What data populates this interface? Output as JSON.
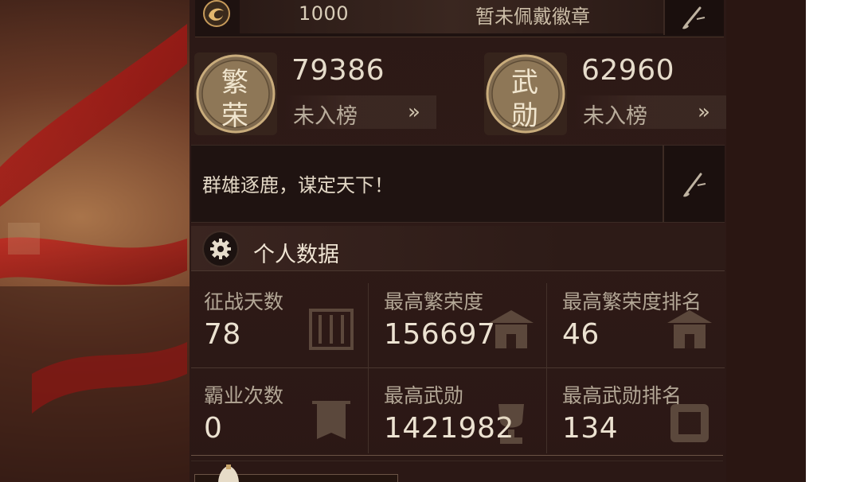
{
  "badge": {
    "points": "1000",
    "status": "暂未佩戴徽章",
    "icon": "dragon-emblem-icon",
    "edit_icon": "brush-edit-icon"
  },
  "ranks": [
    {
      "seal_text": [
        "繁",
        "荣"
      ],
      "value": "79386",
      "status": "未入榜",
      "arrow": "»"
    },
    {
      "seal_text": [
        "武",
        "勋"
      ],
      "value": "62960",
      "status": "未入榜",
      "arrow": "»"
    }
  ],
  "slogan": {
    "text": "群雄逐鹿，谋定天下！",
    "edit_icon": "brush-edit-icon"
  },
  "personal_stats": {
    "title": "个人数据",
    "icon": "gear-icon",
    "cells": [
      {
        "label": "征战天数",
        "value": "78",
        "art": "scroll-art-icon"
      },
      {
        "label": "最高繁荣度",
        "value": "156697",
        "art": "palace-art-icon"
      },
      {
        "label": "最高繁荣度排名",
        "value": "46",
        "art": "palace-art-icon"
      },
      {
        "label": "霸业次数",
        "value": "0",
        "art": "banner-art-icon"
      },
      {
        "label": "最高武勋",
        "value": "1421982",
        "art": "trophy-art-icon"
      },
      {
        "label": "最高武勋排名",
        "value": "134",
        "art": "seal-art-icon"
      }
    ]
  },
  "colors": {
    "panel": "#2c1916",
    "text_primary": "#ece2d1",
    "text_secondary": "#b3a796",
    "seal_gold": "#b8925c"
  }
}
